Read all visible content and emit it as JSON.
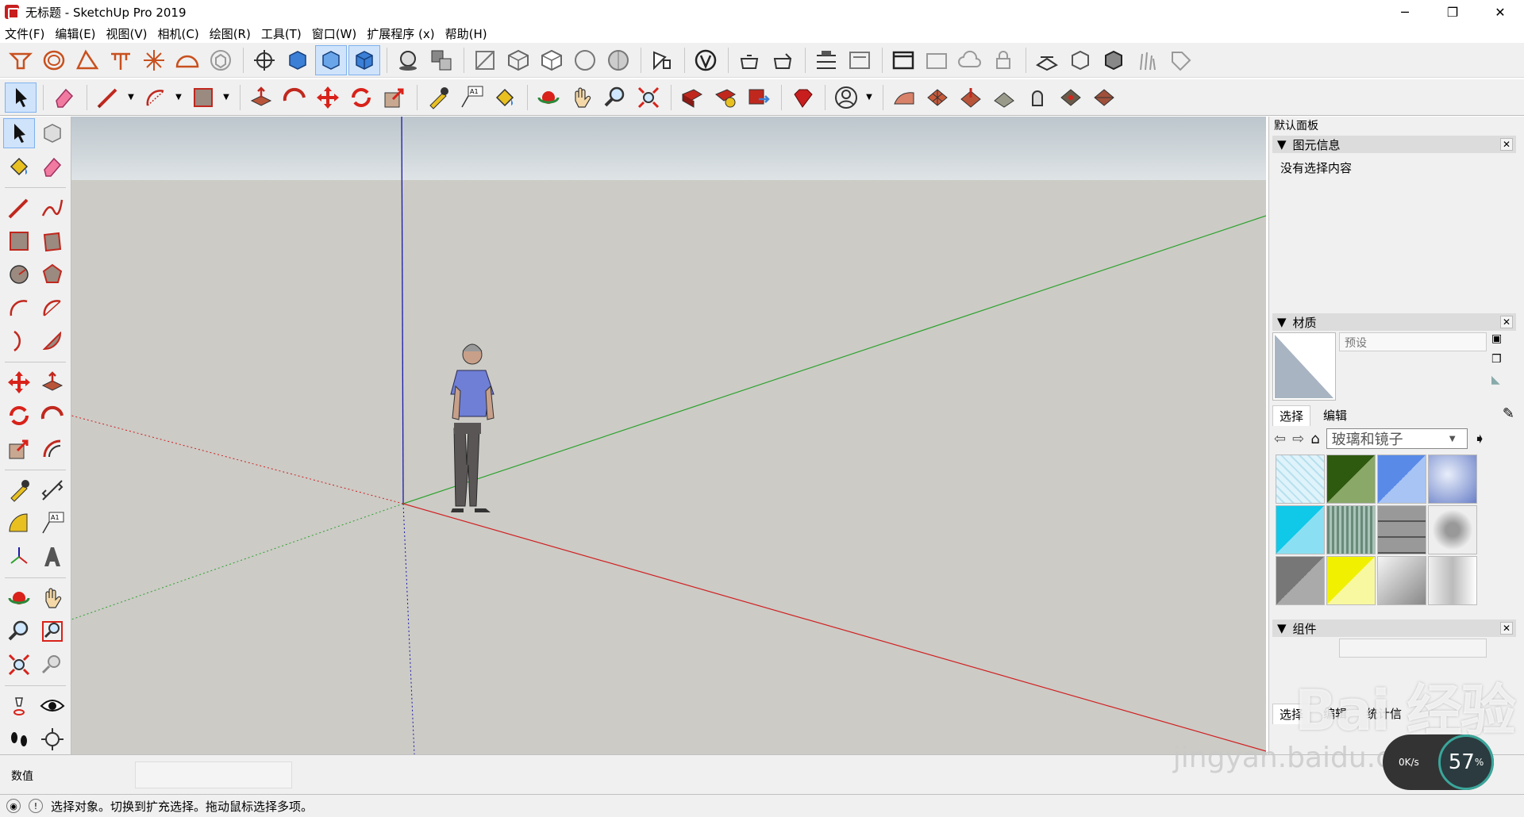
{
  "window": {
    "title": "无标题 - SketchUp Pro 2019",
    "minimize": "─",
    "maximize": "❐",
    "close": "✕"
  },
  "menu": [
    "文件(F)",
    "编辑(E)",
    "视图(V)",
    "相机(C)",
    "绘图(R)",
    "工具(T)",
    "窗口(W)",
    "扩展程序 (x)",
    "帮助(H)"
  ],
  "panel": {
    "title": "默认面板",
    "entity_info": {
      "header": "图元信息",
      "text": "没有选择内容"
    },
    "materials": {
      "header": "材质",
      "name_placeholder": "预设",
      "tabs": [
        "选择",
        "编辑"
      ],
      "collection": "玻璃和镜子"
    },
    "components": {
      "header": "组件",
      "tabs": [
        "选择",
        "编辑",
        "统计信"
      ]
    }
  },
  "status": {
    "vcb_label": "数值",
    "message": "选择对象。切换到扩充选择。拖动鼠标选择多项。"
  },
  "overlay": {
    "watermark": "Bai 经验",
    "watermark_url": "jingyan.baidu.com",
    "speed": "0K/s",
    "percent": "57"
  },
  "colors": {
    "axis_red": "#d02020",
    "axis_green": "#2ea22e",
    "axis_blue": "#1a1aa8",
    "accent": "#c81e1e",
    "ground": "#cccbc6"
  }
}
